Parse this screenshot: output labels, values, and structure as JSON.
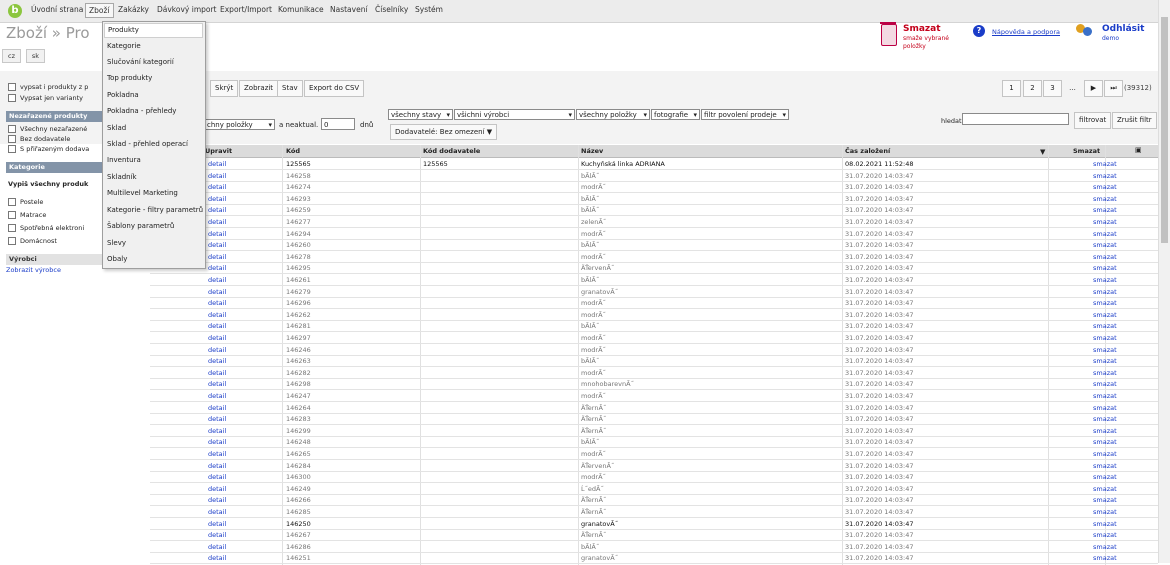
{
  "nav": {
    "logo": "b",
    "items": [
      "Úvodní strana",
      "Zboží",
      "Zakázky",
      "Dávkový import",
      "Export/Import",
      "Komunikace",
      "Nastavení",
      "Číselníky",
      "Systém"
    ]
  },
  "header": {
    "title": "Zboží » Pro",
    "langs": [
      "cz",
      "sk"
    ],
    "delete_title": "Smazat",
    "delete_desc": "smaže vybrané položky",
    "help_icon": "?",
    "help_link": "Nápověda a podpora",
    "logout": "Odhlásit",
    "user": "demo"
  },
  "toolbar": {
    "buttons": [
      "Skrýt",
      "Zobrazit",
      "Stav",
      "Export do CSV"
    ],
    "pages": [
      "1",
      "2",
      "3",
      "...",
      "▶",
      "⏭"
    ],
    "total": "(39312)",
    "items_select": "chny položky",
    "neaktual_label": "a neaktual.",
    "days_value": "0",
    "days_unit": "dnů",
    "filters": [
      "všechny stavy",
      "všichni výrobci",
      "všechny položky",
      "fotografie",
      "filtr povolení prodeje"
    ],
    "supplier_btn": "Dodavatelé: Bez omezení ▼",
    "search_label": "hledat",
    "search_value": "",
    "filter_btn": "filtrovat",
    "clear_btn": "Zrušit filtr"
  },
  "sidebar": {
    "opt1": "vypsat i produkty z p",
    "opt2": "Vypsat jen varianty",
    "unassigned_head": "Nezařazené produkty",
    "unassigned": [
      "Všechny nezařazené",
      "Bez dodavatele",
      "S přiřazeným dodava"
    ],
    "cat_head": "Kategorie",
    "cat_all": "Vypiš všechny produk",
    "cats": [
      "Postele",
      "Matrace",
      "Spotřebná elektroni",
      "Domácnost"
    ],
    "vyrobci_head": "Výrobci",
    "vyrobci_link": "Zobrazit výrobce"
  },
  "dropdown": {
    "items": [
      "Produkty",
      "Kategorie",
      "Slučování kategorií",
      "Top produkty",
      "Pokladna",
      "Pokladna - přehledy",
      "Sklad",
      "Sklad - přehled operací",
      "Inventura",
      "Skladník",
      "Multilevel Marketing",
      "Kategorie - filtry parametrů",
      "Šablony parametrů",
      "Slevy",
      "Obaly"
    ]
  },
  "table": {
    "headers": [
      "Upravit",
      "Kód",
      "Kód dodavatele",
      "Název",
      "Čas založení",
      "Smazat"
    ],
    "rows": [
      {
        "edit": "detail",
        "code": "125565",
        "supplier": "125565",
        "name": "Kuchyňská linka ADRIANA",
        "created": "08.02.2021 11:52:48",
        "delete": "smazat",
        "bold": true
      },
      {
        "edit": "detail",
        "code": "146258",
        "supplier": "",
        "name": "bĂlĂ˝",
        "created": "31.07.2020 14:03:47",
        "delete": "smazat",
        "bold": false
      },
      {
        "edit": "detail",
        "code": "146274",
        "supplier": "",
        "name": "modrĂ˝",
        "created": "31.07.2020 14:03:47",
        "delete": "smazat",
        "bold": false
      },
      {
        "edit": "detail",
        "code": "146293",
        "supplier": "",
        "name": "bĂlĂ˝",
        "created": "31.07.2020 14:03:47",
        "delete": "smazat",
        "bold": false
      },
      {
        "edit": "detail",
        "code": "146259",
        "supplier": "",
        "name": "bĂlĂ˝",
        "created": "31.07.2020 14:03:47",
        "delete": "smazat",
        "bold": false
      },
      {
        "edit": "detail",
        "code": "146277",
        "supplier": "",
        "name": "zelenĂ˝",
        "created": "31.07.2020 14:03:47",
        "delete": "smazat",
        "bold": false
      },
      {
        "edit": "detail",
        "code": "146294",
        "supplier": "",
        "name": "modrĂ˝",
        "created": "31.07.2020 14:03:47",
        "delete": "smazat",
        "bold": false
      },
      {
        "edit": "detail",
        "code": "146260",
        "supplier": "",
        "name": "bĂlĂ˝",
        "created": "31.07.2020 14:03:47",
        "delete": "smazat",
        "bold": false
      },
      {
        "edit": "detail",
        "code": "146278",
        "supplier": "",
        "name": "modrĂ˝",
        "created": "31.07.2020 14:03:47",
        "delete": "smazat",
        "bold": false
      },
      {
        "edit": "detail",
        "code": "146295",
        "supplier": "",
        "name": "ÄŤervenĂ˝",
        "created": "31.07.2020 14:03:47",
        "delete": "smazat",
        "bold": false
      },
      {
        "edit": "detail",
        "code": "146261",
        "supplier": "",
        "name": "bĂlĂ˝",
        "created": "31.07.2020 14:03:47",
        "delete": "smazat",
        "bold": false
      },
      {
        "edit": "detail",
        "code": "146279",
        "supplier": "",
        "name": "granatovĂ˝",
        "created": "31.07.2020 14:03:47",
        "delete": "smazat",
        "bold": false
      },
      {
        "edit": "detail",
        "code": "146296",
        "supplier": "",
        "name": "modrĂ˝",
        "created": "31.07.2020 14:03:47",
        "delete": "smazat",
        "bold": false
      },
      {
        "edit": "detail",
        "code": "146262",
        "supplier": "",
        "name": "modrĂ˝",
        "created": "31.07.2020 14:03:47",
        "delete": "smazat",
        "bold": false
      },
      {
        "edit": "detail",
        "code": "146281",
        "supplier": "",
        "name": "bĂlĂ˝",
        "created": "31.07.2020 14:03:47",
        "delete": "smazat",
        "bold": false
      },
      {
        "edit": "detail",
        "code": "146297",
        "supplier": "",
        "name": "modrĂ˝",
        "created": "31.07.2020 14:03:47",
        "delete": "smazat",
        "bold": false
      },
      {
        "edit": "detail",
        "code": "146246",
        "supplier": "",
        "name": "modrĂ˝",
        "created": "31.07.2020 14:03:47",
        "delete": "smazat",
        "bold": false
      },
      {
        "edit": "detail",
        "code": "146263",
        "supplier": "",
        "name": "bĂlĂ˝",
        "created": "31.07.2020 14:03:47",
        "delete": "smazat",
        "bold": false
      },
      {
        "edit": "detail",
        "code": "146282",
        "supplier": "",
        "name": "modrĂ˝",
        "created": "31.07.2020 14:03:47",
        "delete": "smazat",
        "bold": false
      },
      {
        "edit": "detail",
        "code": "146298",
        "supplier": "",
        "name": "mnohobarevnĂ˝",
        "created": "31.07.2020 14:03:47",
        "delete": "smazat",
        "bold": false
      },
      {
        "edit": "detail",
        "code": "146247",
        "supplier": "",
        "name": "modrĂ˝",
        "created": "31.07.2020 14:03:47",
        "delete": "smazat",
        "bold": false
      },
      {
        "edit": "detail",
        "code": "146264",
        "supplier": "",
        "name": "ÄŤernĂ˝",
        "created": "31.07.2020 14:03:47",
        "delete": "smazat",
        "bold": false
      },
      {
        "edit": "detail",
        "code": "146283",
        "supplier": "",
        "name": "ÄŤernĂ˝",
        "created": "31.07.2020 14:03:47",
        "delete": "smazat",
        "bold": false
      },
      {
        "edit": "detail",
        "code": "146299",
        "supplier": "",
        "name": "ÄŤernĂ˝",
        "created": "31.07.2020 14:03:47",
        "delete": "smazat",
        "bold": false
      },
      {
        "edit": "detail",
        "code": "146248",
        "supplier": "",
        "name": "bĂlĂ˝",
        "created": "31.07.2020 14:03:47",
        "delete": "smazat",
        "bold": false
      },
      {
        "edit": "detail",
        "code": "146265",
        "supplier": "",
        "name": "modrĂ˝",
        "created": "31.07.2020 14:03:47",
        "delete": "smazat",
        "bold": false
      },
      {
        "edit": "detail",
        "code": "146284",
        "supplier": "",
        "name": "ÄŤervenĂ˝",
        "created": "31.07.2020 14:03:47",
        "delete": "smazat",
        "bold": false
      },
      {
        "edit": "detail",
        "code": "146300",
        "supplier": "",
        "name": "modrĂ˝",
        "created": "31.07.2020 14:03:47",
        "delete": "smazat",
        "bold": false
      },
      {
        "edit": "detail",
        "code": "146249",
        "supplier": "",
        "name": "Ĺ˝edĂ˝",
        "created": "31.07.2020 14:03:47",
        "delete": "smazat",
        "bold": false
      },
      {
        "edit": "detail",
        "code": "146266",
        "supplier": "",
        "name": "ÄŤernĂ˝",
        "created": "31.07.2020 14:03:47",
        "delete": "smazat",
        "bold": false
      },
      {
        "edit": "detail",
        "code": "146285",
        "supplier": "",
        "name": "ÄŤernĂ˝",
        "created": "31.07.2020 14:03:47",
        "delete": "smazat",
        "bold": false
      },
      {
        "edit": "detail",
        "code": "146250",
        "supplier": "",
        "name": "granatovĂ˝",
        "created": "31.07.2020 14:03:47",
        "delete": "smazat",
        "bold": true
      },
      {
        "edit": "detail",
        "code": "146267",
        "supplier": "",
        "name": "ÄŤernĂ˝",
        "created": "31.07.2020 14:03:47",
        "delete": "smazat",
        "bold": false
      },
      {
        "edit": "detail",
        "code": "146286",
        "supplier": "",
        "name": "bĂlĂ˝",
        "created": "31.07.2020 14:03:47",
        "delete": "smazat",
        "bold": false
      },
      {
        "edit": "detail",
        "code": "146251",
        "supplier": "",
        "name": "granatovĂ˝",
        "created": "31.07.2020 14:03:47",
        "delete": "smazat",
        "bold": false
      }
    ]
  }
}
